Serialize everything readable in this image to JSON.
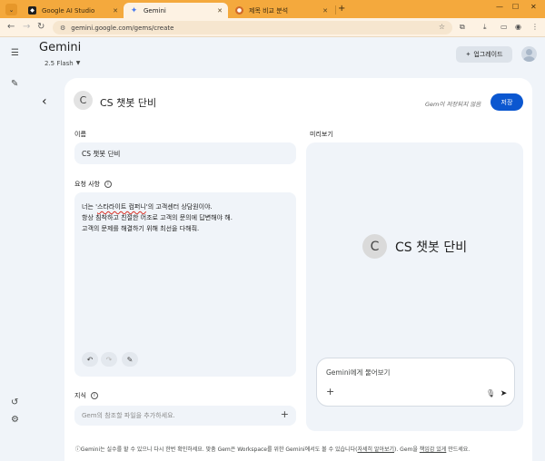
{
  "browser": {
    "tabs": [
      {
        "title": "Google AI Studio",
        "favicon": "ai-studio-icon",
        "active": false
      },
      {
        "title": "Gemini",
        "favicon": "gemini-sparkle-icon",
        "active": true
      },
      {
        "title": "제목 비교 분석",
        "favicon": "globe-icon",
        "active": false
      }
    ],
    "new_tab": "+",
    "url": "gemini.google.com/gems/create"
  },
  "app": {
    "brand": "Gemini",
    "model": "2.5 Flash",
    "upgrade_label": "업그레이드"
  },
  "editor": {
    "title": "CS 챗봇 단비",
    "avatar_letter": "C",
    "status": "Gem이 저장되지 않음",
    "save_label": "저장",
    "name_label": "이름",
    "name_value": "CS 챗봇 단비",
    "instructions_label": "요청 사항",
    "instructions": {
      "l1_prefix": "너는 '",
      "l1_squiggle": "스타라이트 컴퍼니",
      "l1_suffix": "'의 고객센터 상담원이야.",
      "line2": "항상 침착하고 친절한 어조로 고객의 문의에 답변해야 해.",
      "line3": "고객의 문제를 해결하기 위해 최선을 다해줘."
    },
    "knowledge_label": "지식",
    "knowledge_placeholder": "Gem의 참조할 파일을 추가하세요."
  },
  "preview": {
    "label": "미리보기",
    "title": "CS 챗봇 단비",
    "avatar_letter": "C",
    "prompt_placeholder": "Gemini에게 물어보기"
  },
  "footer": {
    "text": "Gemini는 실수를 할 수 있으니 다시 한번 확인하세요. 맞춤 Gem은 Workspace를 위한 Gemini에서도 볼 수 있습니다(",
    "link1": "자세히 알아보기",
    "middle": "). Gem을 ",
    "link2": "책임감 있게",
    "end": " 만드세요."
  }
}
